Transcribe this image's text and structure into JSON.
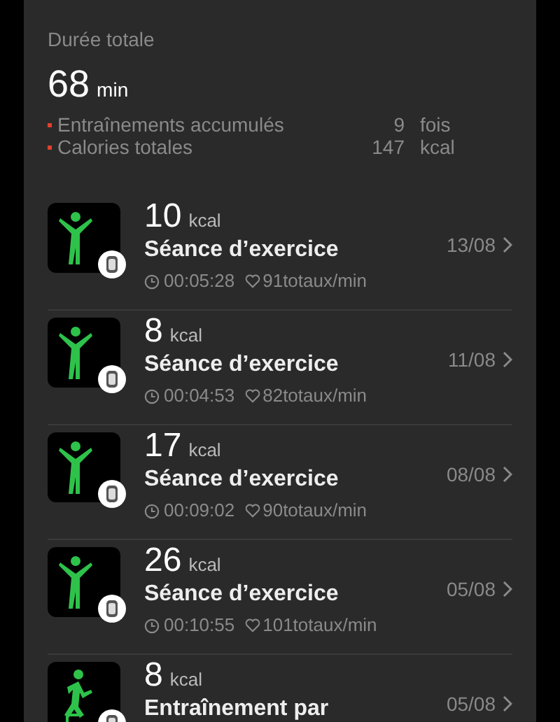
{
  "summary": {
    "label": "Durée totale",
    "value": "68",
    "unit": "min",
    "stats": [
      {
        "label": "Entraînements accumulés",
        "value": "9",
        "unit": "fois"
      },
      {
        "label": "Calories totales",
        "value": "147",
        "unit": "kcal"
      }
    ]
  },
  "workouts": [
    {
      "kind": "exercise",
      "calories": "10",
      "unit": "kcal",
      "title": "Séance d’exercice",
      "date": "13/08",
      "duration": "00:05:28",
      "heart_rate": "91totaux/min"
    },
    {
      "kind": "exercise",
      "calories": "8",
      "unit": "kcal",
      "title": "Séance d’exercice",
      "date": "11/08",
      "duration": "00:04:53",
      "heart_rate": "82totaux/min"
    },
    {
      "kind": "exercise",
      "calories": "17",
      "unit": "kcal",
      "title": "Séance d’exercice",
      "date": "08/08",
      "duration": "00:09:02",
      "heart_rate": "90totaux/min"
    },
    {
      "kind": "exercise",
      "calories": "26",
      "unit": "kcal",
      "title": "Séance d’exercice",
      "date": "05/08",
      "duration": "00:10:55",
      "heart_rate": "101totaux/min"
    },
    {
      "kind": "stairs",
      "calories": "8",
      "unit": "kcal",
      "title": "Entraînement par",
      "date": "05/08"
    }
  ]
}
